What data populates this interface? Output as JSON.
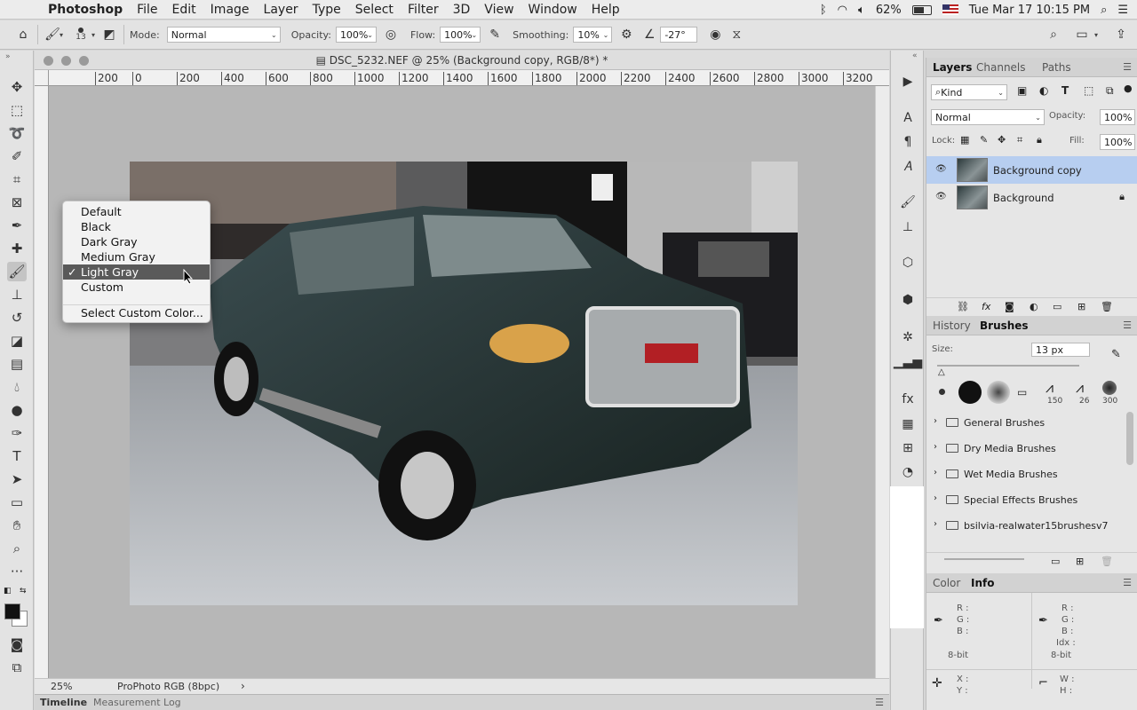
{
  "menubar": {
    "app_name": "Photoshop",
    "menus": [
      "File",
      "Edit",
      "Image",
      "Layer",
      "Type",
      "Select",
      "Filter",
      "3D",
      "View",
      "Window",
      "Help"
    ],
    "battery": "62%",
    "battery_level": 0.62,
    "clock": "Tue Mar 17  10:15 PM"
  },
  "options": {
    "brush_size": "13",
    "mode_label": "Mode:",
    "mode_value": "Normal",
    "opacity_label": "Opacity:",
    "opacity_value": "100%",
    "flow_label": "Flow:",
    "flow_value": "100%",
    "smoothing_label": "Smoothing:",
    "smoothing_value": "10%",
    "angle_value": "-27°"
  },
  "document": {
    "title": "DSC_5232.NEF @ 25% (Background copy, RGB/8*) *",
    "ruler_labels": [
      "200",
      "0",
      "200",
      "400",
      "600",
      "800",
      "1000",
      "1200",
      "1400",
      "1600",
      "1800",
      "2000",
      "2200",
      "2400",
      "2600",
      "2800",
      "3000",
      "3200"
    ],
    "zoom": "25%",
    "profile": "ProPhoto RGB (8bpc)",
    "timeline_tab": "Timeline",
    "measurement_tab": "Measurement Log"
  },
  "context_menu": {
    "items": [
      "Default",
      "Black",
      "Dark Gray",
      "Medium Gray",
      "Light Gray",
      "Custom"
    ],
    "selected": "Light Gray",
    "check": "✓",
    "custom_color": "Select Custom Color..."
  },
  "layers_panel": {
    "tabs": [
      "Layers",
      "Channels",
      "Paths"
    ],
    "filter_kind": "Kind",
    "blend_mode": "Normal",
    "opacity_label": "Opacity:",
    "opacity_value": "100%",
    "lock_label": "Lock:",
    "fill_label": "Fill:",
    "fill_value": "100%",
    "layers": [
      {
        "name": "Background copy",
        "selected": true
      },
      {
        "name": "Background",
        "locked": true
      }
    ]
  },
  "brushes_panel": {
    "tabs": [
      "History",
      "Brushes"
    ],
    "size_label": "Size:",
    "size_value": "13 px",
    "presets": [
      "150",
      "26",
      "300"
    ],
    "folders": [
      "General Brushes",
      "Dry Media Brushes",
      "Wet Media Brushes",
      "Special Effects Brushes",
      "bsilvia-realwater15brushesv7"
    ]
  },
  "info_panel": {
    "tabs": [
      "Color",
      "Info"
    ],
    "rgb_left": [
      "R :",
      "G :",
      "B :"
    ],
    "rgb_right": [
      "R :",
      "G :",
      "B :",
      "Idx :"
    ],
    "bit_left": "8-bit",
    "bit_right": "8-bit",
    "xy": [
      "X :",
      "Y :"
    ],
    "wh": [
      "W :",
      "H :"
    ]
  },
  "colors": {
    "selected_layer": "#b7cef0",
    "menu_highlight": "#5a5a5a",
    "canvas_bg": "#b7b7b7"
  }
}
